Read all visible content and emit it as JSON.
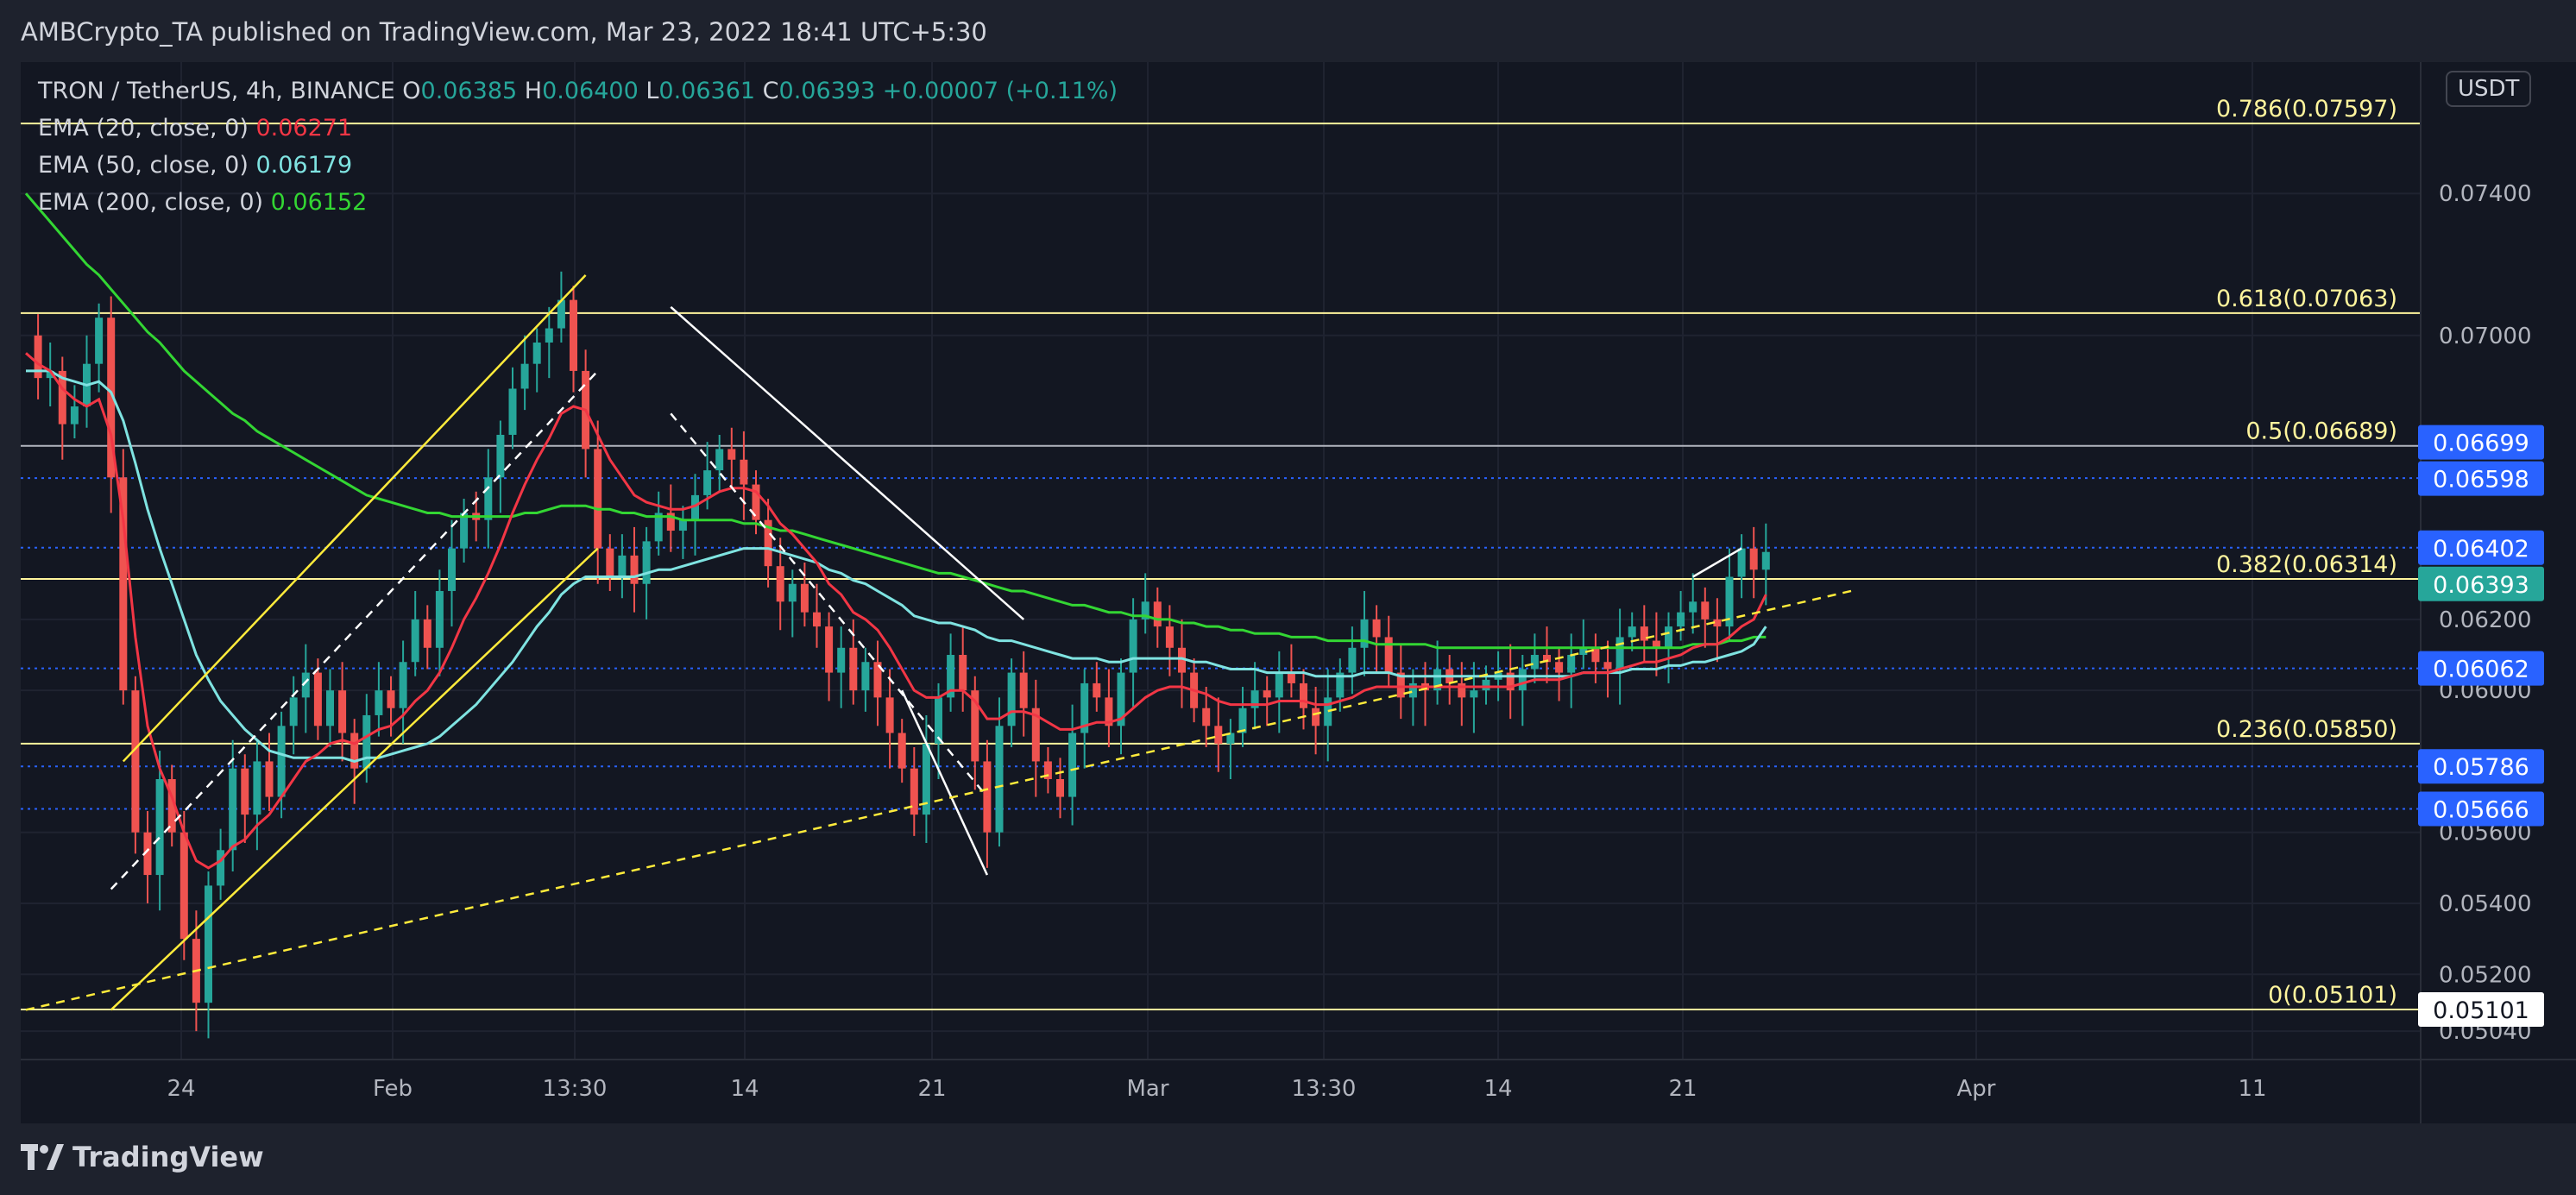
{
  "header": {
    "published": "AMBCrypto_TA published on TradingView.com, Mar 23, 2022 18:41 UTC+5:30"
  },
  "legend": {
    "symbol": "TRON / TetherUS, 4h, BINANCE",
    "ohlc": [
      {
        "k": "O",
        "v": "0.06385"
      },
      {
        "k": "H",
        "v": "0.06400"
      },
      {
        "k": "L",
        "v": "0.06361"
      },
      {
        "k": "C",
        "v": "0.06393"
      }
    ],
    "change": "+0.00007 (+0.11%)",
    "ema": [
      {
        "label": "EMA (20, close, 0)",
        "value": "0.06271",
        "color": "#f23645"
      },
      {
        "label": "EMA (50, close, 0)",
        "value": "0.06179",
        "color": "#7fe3e1"
      },
      {
        "label": "EMA (200, close, 0)",
        "value": "0.06152",
        "color": "#33d633"
      }
    ]
  },
  "axis": {
    "currency": "USDT"
  },
  "brand": {
    "name": "TradingView"
  },
  "chart_data": {
    "type": "candlestick",
    "symbol": "TRONUSDT",
    "timeframe": "4h",
    "ylim": [
      0.0496,
      0.0777
    ],
    "y_ticks": [
      "0.05040",
      "0.05200",
      "0.05400",
      "0.05600",
      "0.06000",
      "0.06200",
      "0.07000",
      "0.07400"
    ],
    "x_ticks": [
      "24",
      "Feb",
      "13:30",
      "14",
      "21",
      "Mar",
      "13:30",
      "14",
      "21",
      "Apr",
      "11"
    ],
    "fib_levels": [
      {
        "label": "0.786(0.07597)",
        "value": 0.07597
      },
      {
        "label": "0.618(0.07063)",
        "value": 0.07063
      },
      {
        "label": "0.5(0.06689)",
        "value": 0.06689
      },
      {
        "label": "0.382(0.06314)",
        "value": 0.06314
      },
      {
        "label": "0.236(0.05850)",
        "value": 0.0585
      },
      {
        "label": "0(0.05101)",
        "value": 0.05101
      }
    ],
    "price_labels": [
      {
        "text": "0.06699",
        "value": 0.06699,
        "bg": "#2962ff",
        "fg": "#ffffff"
      },
      {
        "text": "0.06598",
        "value": 0.06598,
        "bg": "#2962ff",
        "fg": "#ffffff"
      },
      {
        "text": "0.06402",
        "value": 0.06402,
        "bg": "#2962ff",
        "fg": "#ffffff"
      },
      {
        "text": "0.06393",
        "value": 0.06393,
        "bg": "#26a69a",
        "fg": "#ffffff"
      },
      {
        "text": "0.06062",
        "value": 0.06062,
        "bg": "#2962ff",
        "fg": "#ffffff"
      },
      {
        "text": "0.05786",
        "value": 0.05786,
        "bg": "#2962ff",
        "fg": "#ffffff"
      },
      {
        "text": "0.05666",
        "value": 0.05666,
        "bg": "#2962ff",
        "fg": "#ffffff"
      },
      {
        "text": "0.05101",
        "value": 0.05101,
        "bg": "#ffffff",
        "fg": "#131722"
      }
    ],
    "dotted_levels": [
      0.06598,
      0.06402,
      0.06062,
      0.05786,
      0.05666
    ],
    "close_series": [
      0.07,
      0.0688,
      0.069,
      0.0675,
      0.068,
      0.0692,
      0.0705,
      0.066,
      0.06,
      0.056,
      0.0548,
      0.0575,
      0.056,
      0.053,
      0.0512,
      0.0545,
      0.0555,
      0.0578,
      0.0565,
      0.058,
      0.057,
      0.059,
      0.0598,
      0.0605,
      0.059,
      0.06,
      0.0588,
      0.0578,
      0.0593,
      0.06,
      0.0595,
      0.0608,
      0.062,
      0.0612,
      0.0628,
      0.064,
      0.065,
      0.0648,
      0.066,
      0.0672,
      0.0685,
      0.0692,
      0.0698,
      0.0702,
      0.071,
      0.069,
      0.0668,
      0.064,
      0.0632,
      0.0638,
      0.063,
      0.0642,
      0.065,
      0.0645,
      0.0648,
      0.0655,
      0.0662,
      0.0668,
      0.0665,
      0.0658,
      0.0648,
      0.0635,
      0.0625,
      0.063,
      0.0622,
      0.0618,
      0.0605,
      0.0612,
      0.06,
      0.0608,
      0.0598,
      0.0588,
      0.0578,
      0.0565,
      0.0585,
      0.0598,
      0.061,
      0.06,
      0.058,
      0.056,
      0.059,
      0.0605,
      0.0595,
      0.058,
      0.0575,
      0.057,
      0.0588,
      0.0602,
      0.0598,
      0.059,
      0.0605,
      0.062,
      0.0625,
      0.0618,
      0.0612,
      0.0605,
      0.0595,
      0.059,
      0.0585,
      0.0588,
      0.0595,
      0.06,
      0.0598,
      0.0605,
      0.0602,
      0.0595,
      0.059,
      0.0598,
      0.0605,
      0.0612,
      0.062,
      0.0615,
      0.0605,
      0.0598,
      0.0602,
      0.06,
      0.0606,
      0.0602,
      0.0598,
      0.06,
      0.0603,
      0.0605,
      0.06,
      0.0606,
      0.061,
      0.0608,
      0.0605,
      0.061,
      0.0612,
      0.0608,
      0.0606,
      0.0615,
      0.0618,
      0.0614,
      0.0612,
      0.0618,
      0.0622,
      0.0625,
      0.062,
      0.0618,
      0.0632,
      0.064,
      0.0634,
      0.0639
    ],
    "ema20": [
      0.0695,
      0.0692,
      0.069,
      0.0685,
      0.0682,
      0.068,
      0.0682,
      0.0672,
      0.0648,
      0.0615,
      0.059,
      0.0578,
      0.057,
      0.056,
      0.0552,
      0.055,
      0.0552,
      0.0556,
      0.0558,
      0.0562,
      0.0565,
      0.057,
      0.0575,
      0.058,
      0.0582,
      0.0585,
      0.0586,
      0.0585,
      0.0587,
      0.0589,
      0.059,
      0.0593,
      0.0597,
      0.06,
      0.0605,
      0.0612,
      0.062,
      0.0626,
      0.0633,
      0.0641,
      0.065,
      0.0658,
      0.0665,
      0.0671,
      0.0678,
      0.068,
      0.0679,
      0.0672,
      0.0665,
      0.066,
      0.0655,
      0.0653,
      0.0652,
      0.0651,
      0.0651,
      0.0652,
      0.0654,
      0.0656,
      0.0657,
      0.0657,
      0.0656,
      0.0652,
      0.0647,
      0.0644,
      0.064,
      0.0636,
      0.063,
      0.0627,
      0.0622,
      0.062,
      0.0617,
      0.0612,
      0.0606,
      0.06,
      0.0598,
      0.0598,
      0.06,
      0.06,
      0.0597,
      0.0592,
      0.0592,
      0.0594,
      0.0594,
      0.0593,
      0.0591,
      0.0589,
      0.0589,
      0.059,
      0.0591,
      0.0591,
      0.0592,
      0.0595,
      0.0598,
      0.06,
      0.0601,
      0.0601,
      0.06,
      0.0599,
      0.0597,
      0.0596,
      0.0596,
      0.0596,
      0.0596,
      0.0597,
      0.0597,
      0.0597,
      0.0596,
      0.0596,
      0.0597,
      0.0598,
      0.06,
      0.0601,
      0.0601,
      0.0601,
      0.0601,
      0.0601,
      0.0601,
      0.0601,
      0.0601,
      0.0601,
      0.0601,
      0.0601,
      0.0601,
      0.0602,
      0.0603,
      0.0603,
      0.0603,
      0.0604,
      0.0605,
      0.0605,
      0.0605,
      0.0606,
      0.0607,
      0.0608,
      0.0608,
      0.0609,
      0.061,
      0.0612,
      0.0613,
      0.0613,
      0.0615,
      0.0618,
      0.062,
      0.0627
    ],
    "ema50": [
      0.069,
      0.069,
      0.069,
      0.0688,
      0.0687,
      0.0686,
      0.0687,
      0.0684,
      0.0676,
      0.0664,
      0.0651,
      0.064,
      0.063,
      0.062,
      0.061,
      0.0603,
      0.0597,
      0.0593,
      0.0589,
      0.0586,
      0.0583,
      0.0582,
      0.0581,
      0.0581,
      0.0581,
      0.0581,
      0.0581,
      0.058,
      0.0581,
      0.0581,
      0.0582,
      0.0583,
      0.0584,
      0.0585,
      0.0587,
      0.059,
      0.0593,
      0.0596,
      0.06,
      0.0604,
      0.0608,
      0.0613,
      0.0618,
      0.0622,
      0.0627,
      0.063,
      0.0632,
      0.0632,
      0.0632,
      0.0632,
      0.0632,
      0.0633,
      0.0634,
      0.0634,
      0.0635,
      0.0636,
      0.0637,
      0.0638,
      0.0639,
      0.064,
      0.064,
      0.064,
      0.0639,
      0.0638,
      0.0637,
      0.0636,
      0.0634,
      0.0633,
      0.0631,
      0.063,
      0.0628,
      0.0626,
      0.0624,
      0.0621,
      0.062,
      0.0619,
      0.0619,
      0.0618,
      0.0617,
      0.0615,
      0.0614,
      0.0614,
      0.0613,
      0.0612,
      0.0611,
      0.061,
      0.0609,
      0.0609,
      0.0609,
      0.0608,
      0.0608,
      0.0609,
      0.0609,
      0.0609,
      0.0609,
      0.0609,
      0.0608,
      0.0608,
      0.0607,
      0.0606,
      0.0606,
      0.0606,
      0.0605,
      0.0605,
      0.0605,
      0.0605,
      0.0604,
      0.0604,
      0.0604,
      0.0604,
      0.0605,
      0.0605,
      0.0605,
      0.0604,
      0.0604,
      0.0604,
      0.0604,
      0.0604,
      0.0604,
      0.0604,
      0.0604,
      0.0604,
      0.0604,
      0.0604,
      0.0604,
      0.0604,
      0.0604,
      0.0604,
      0.0605,
      0.0605,
      0.0605,
      0.0605,
      0.0606,
      0.0606,
      0.0606,
      0.0607,
      0.0607,
      0.0608,
      0.0608,
      0.0609,
      0.061,
      0.0611,
      0.0613,
      0.0618
    ],
    "ema200": [
      0.074,
      0.0736,
      0.0732,
      0.0728,
      0.0724,
      0.072,
      0.0717,
      0.0713,
      0.0709,
      0.0705,
      0.0701,
      0.0698,
      0.0694,
      0.069,
      0.0687,
      0.0684,
      0.0681,
      0.0678,
      0.0676,
      0.0673,
      0.0671,
      0.0669,
      0.0667,
      0.0665,
      0.0663,
      0.0661,
      0.0659,
      0.0657,
      0.0655,
      0.0654,
      0.0653,
      0.0652,
      0.0651,
      0.065,
      0.065,
      0.0649,
      0.0649,
      0.0649,
      0.0649,
      0.0649,
      0.0649,
      0.065,
      0.065,
      0.0651,
      0.0652,
      0.0652,
      0.0652,
      0.0651,
      0.0651,
      0.065,
      0.065,
      0.0649,
      0.0649,
      0.0649,
      0.0648,
      0.0648,
      0.0648,
      0.0648,
      0.0648,
      0.0647,
      0.0647,
      0.0646,
      0.0645,
      0.0645,
      0.0644,
      0.0643,
      0.0642,
      0.0641,
      0.064,
      0.0639,
      0.0638,
      0.0637,
      0.0636,
      0.0635,
      0.0634,
      0.0633,
      0.0633,
      0.0632,
      0.0631,
      0.063,
      0.0629,
      0.0628,
      0.0628,
      0.0627,
      0.0626,
      0.0625,
      0.0624,
      0.0624,
      0.0623,
      0.0622,
      0.0622,
      0.0621,
      0.0621,
      0.062,
      0.062,
      0.0619,
      0.0619,
      0.0618,
      0.0618,
      0.0617,
      0.0617,
      0.0616,
      0.0616,
      0.0616,
      0.0615,
      0.0615,
      0.0615,
      0.0614,
      0.0614,
      0.0614,
      0.0614,
      0.0613,
      0.0613,
      0.0613,
      0.0613,
      0.0613,
      0.0612,
      0.0612,
      0.0612,
      0.0612,
      0.0612,
      0.0612,
      0.0612,
      0.0612,
      0.0612,
      0.0612,
      0.0612,
      0.0612,
      0.0612,
      0.0612,
      0.0612,
      0.0612,
      0.0612,
      0.0612,
      0.0612,
      0.0612,
      0.0612,
      0.0613,
      0.0613,
      0.0613,
      0.0614,
      0.0614,
      0.0615,
      0.0615
    ],
    "trendlines": [
      {
        "name": "ascending-channel-upper",
        "color": "#ffeb3b",
        "dash": false,
        "points": [
          [
            8,
            0.058
          ],
          [
            46,
            0.0717
          ]
        ]
      },
      {
        "name": "ascending-channel-lower",
        "color": "#ffeb3b",
        "dash": false,
        "points": [
          [
            7,
            0.051
          ],
          [
            47,
            0.064
          ]
        ]
      },
      {
        "name": "ascending-channel-mid",
        "color": "#ffffff",
        "dash": true,
        "points": [
          [
            7,
            0.0544
          ],
          [
            47,
            0.069
          ]
        ]
      },
      {
        "name": "descending-channel-upper",
        "color": "#ffffff",
        "dash": false,
        "points": [
          [
            53,
            0.0708
          ],
          [
            82,
            0.062
          ]
        ]
      },
      {
        "name": "descending-channel-lower",
        "color": "#ffffff",
        "dash": false,
        "points": [
          [
            72,
            0.06
          ],
          [
            79,
            0.0548
          ]
        ]
      },
      {
        "name": "descending-channel-mid",
        "color": "#ffffff",
        "dash": true,
        "points": [
          [
            53,
            0.0678
          ],
          [
            79,
            0.057
          ]
        ]
      },
      {
        "name": "support-trendline",
        "color": "#ffeb3b",
        "dash": true,
        "points": [
          [
            0,
            0.051
          ],
          [
            150,
            0.0628
          ]
        ]
      },
      {
        "name": "breakout-line",
        "color": "#ffffff",
        "dash": false,
        "points": [
          [
            137,
            0.0632
          ],
          [
            141,
            0.064
          ]
        ]
      }
    ]
  }
}
